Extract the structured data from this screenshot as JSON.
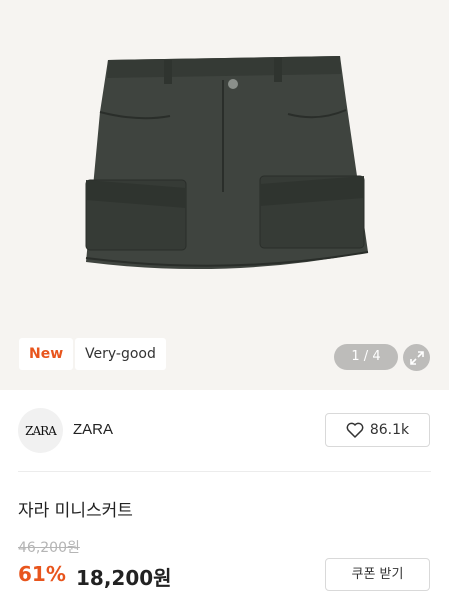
{
  "colors": {
    "accent": "#e8551d",
    "hero_bg": "#f6f4f1",
    "skirt": "#3f443f"
  },
  "product": {
    "image_icon": "olive-cargo-mini-skirt",
    "tags": {
      "new": "New",
      "condition": "Very-good"
    },
    "pager": "1 / 4",
    "title": "자라 미니스커트",
    "original_price": "46,200원",
    "discount": "61%",
    "price": "18,200원"
  },
  "brand": {
    "logo_text": "ZARA",
    "name": "ZARA"
  },
  "like": {
    "count": "86.1k",
    "icon": "heart-icon"
  },
  "coupon": {
    "label": "쿠폰 받기"
  }
}
